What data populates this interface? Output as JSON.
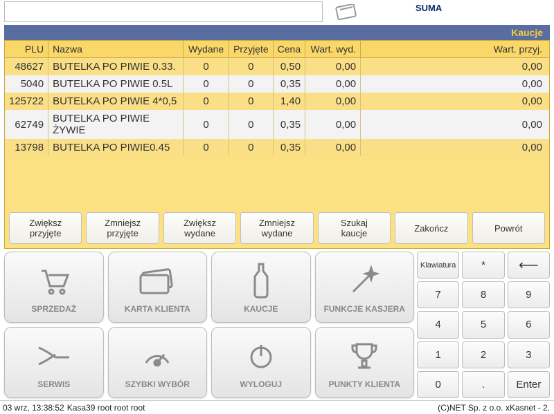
{
  "header": {
    "suma_label": "SUMA",
    "panel_title": "Kaucje"
  },
  "table": {
    "columns": {
      "plu": "PLU",
      "nazwa": "Nazwa",
      "wydane": "Wydane",
      "przyjete": "Przyjęte",
      "cena": "Cena",
      "wart_wyd": "Wart. wyd.",
      "wart_przyj": "Wart. przyj."
    },
    "rows": [
      {
        "plu": "48627",
        "nazwa": "BUTELKA PO PIWIE 0.33.",
        "wydane": "0",
        "przyjete": "0",
        "cena": "0,50",
        "wart_wyd": "0,00",
        "wart_przyj": "0,00"
      },
      {
        "plu": "5040",
        "nazwa": "BUTELKA PO PIWIE 0.5L",
        "wydane": "0",
        "przyjete": "0",
        "cena": "0,35",
        "wart_wyd": "0,00",
        "wart_przyj": "0,00"
      },
      {
        "plu": "125722",
        "nazwa": "BUTELKA PO PIWIE 4*0,5",
        "wydane": "0",
        "przyjete": "0",
        "cena": "1,40",
        "wart_wyd": "0,00",
        "wart_przyj": "0,00"
      },
      {
        "plu": "62749",
        "nazwa": "BUTELKA PO PIWIE ŻYWIE",
        "wydane": "0",
        "przyjete": "0",
        "cena": "0,35",
        "wart_wyd": "0,00",
        "wart_przyj": "0,00"
      },
      {
        "plu": "13798",
        "nazwa": "BUTELKA PO PIWIE0.45",
        "wydane": "0",
        "przyjete": "0",
        "cena": "0,35",
        "wart_wyd": "0,00",
        "wart_przyj": "0,00"
      }
    ]
  },
  "deposit_buttons": {
    "zwieksz_przyjete": "Zwiększ\nprzyjęte",
    "zmniejsz_przyjete": "Zmniejsz\nprzyjęte",
    "zwieksz_wydane": "Zwiększ\nwydane",
    "zmniejsz_wydane": "Zmniejsz\nwydane",
    "szukaj_kaucje": "Szukaj\nkaucje",
    "zakoncz": "Zakończ",
    "powrot": "Powrót"
  },
  "function_buttons": {
    "sprzedaz": "SPRZEDAŻ",
    "karta_klienta": "KARTA KLIENTA",
    "kaucje": "KAUCJE",
    "funkcje_kasjera": "FUNKCJE KASJERA",
    "serwis": "SERWIS",
    "szybki_wybor": "SZYBKI WYBÓR",
    "wyloguj": "WYLOGUJ",
    "punkty_klienta": "PUNKTY KLIENTA"
  },
  "keypad": {
    "klawiatura": "Klawiatura",
    "star": "*",
    "back": "←",
    "k7": "7",
    "k8": "8",
    "k9": "9",
    "k4": "4",
    "k5": "5",
    "k6": "6",
    "k1": "1",
    "k2": "2",
    "k3": "3",
    "k0": "0",
    "dot": ".",
    "enter": "Enter"
  },
  "status": {
    "datetime": "03 wrz, 13:38:52",
    "terminal": "Kasa39 root root root",
    "copyright": "(C)NET Sp. z o.o.  xKasnet - 2."
  }
}
